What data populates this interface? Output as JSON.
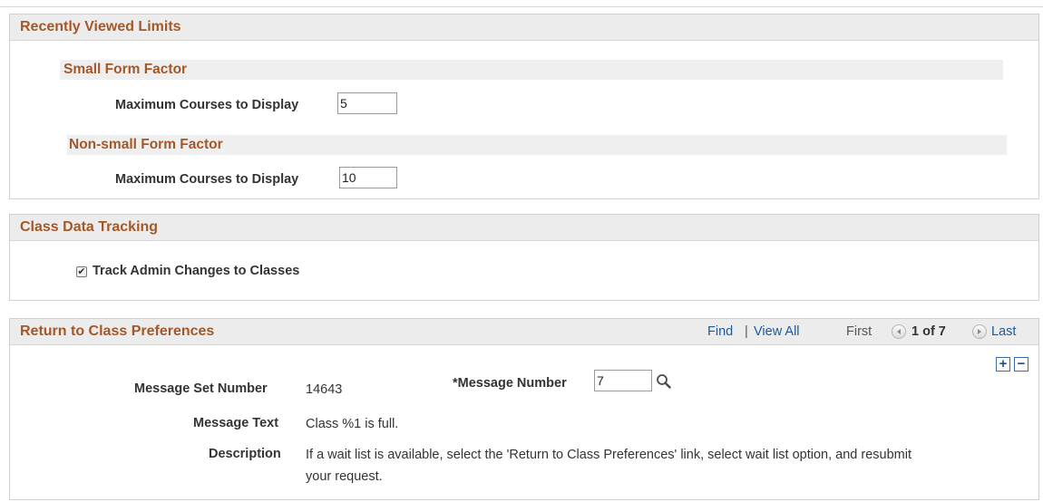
{
  "recently_viewed": {
    "title": "Recently Viewed Limits",
    "small": {
      "title": "Small Form Factor",
      "label": "Maximum Courses to Display",
      "value": "5"
    },
    "nonsmall": {
      "title": "Non-small Form Factor",
      "label": "Maximum Courses to Display",
      "value": "10"
    }
  },
  "class_data": {
    "title": "Class Data Tracking",
    "checkbox_label": "Track Admin Changes to Classes",
    "checked": true
  },
  "return_prefs": {
    "title": "Return to Class Preferences",
    "nav": {
      "find": "Find",
      "sep": "|",
      "view_all": "View All",
      "first": "First",
      "position": "1 of 7",
      "last": "Last"
    },
    "add_symbol": "+",
    "remove_symbol": "−",
    "message_set_label": "Message Set Number",
    "message_set_value": "14643",
    "message_number_label": "*Message Number",
    "message_number_value": "7",
    "message_text_label": "Message Text",
    "message_text_value": "Class  %1 is full.",
    "description_label": "Description",
    "description_line1": "If a wait list is available, select the 'Return to Class Preferences' link, select wait list option, and resubmit",
    "description_line2": "your request."
  }
}
